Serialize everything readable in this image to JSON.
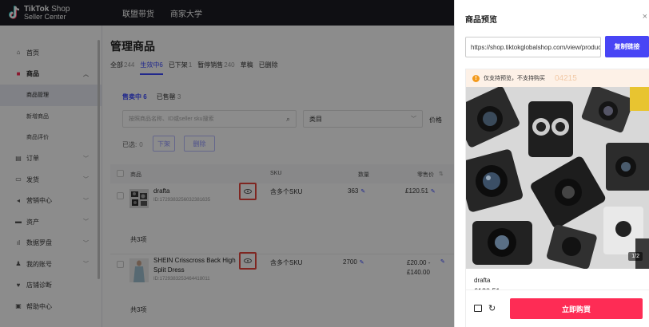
{
  "topbar": {
    "logo_brand": "TikTok",
    "logo_shop": "Shop",
    "logo_sub": "Seller Center",
    "nav": [
      "联盟带货",
      "商家大学"
    ]
  },
  "sidebar": {
    "items": [
      {
        "label": "首页",
        "icon": "home-icon",
        "chevron": ""
      },
      {
        "label": "商品",
        "icon": "product-icon",
        "chevron": "︿"
      },
      {
        "label": "商品管理"
      },
      {
        "label": "新增商品"
      },
      {
        "label": "商品评价"
      },
      {
        "label": "订单",
        "icon": "order-icon",
        "chevron": "﹀"
      },
      {
        "label": "发货",
        "icon": "shipping-icon",
        "chevron": "﹀"
      },
      {
        "label": "营销中心",
        "icon": "marketing-icon",
        "chevron": "﹀"
      },
      {
        "label": "资产",
        "icon": "wallet-icon",
        "chevron": "﹀"
      },
      {
        "label": "数据罗盘",
        "icon": "chart-icon",
        "chevron": "﹀"
      },
      {
        "label": "我的账号",
        "icon": "user-icon",
        "chevron": "﹀"
      },
      {
        "label": "店铺诊断",
        "icon": "heart-icon",
        "chevron": ""
      },
      {
        "label": "帮助中心",
        "icon": "help-icon",
        "chevron": ""
      }
    ]
  },
  "main": {
    "title": "管理商品",
    "tabs": [
      {
        "label": "全部",
        "count": "244"
      },
      {
        "label": "生效中",
        "count": "6"
      },
      {
        "label": "已下架",
        "count": "1"
      },
      {
        "label": "暂停销售",
        "count": "240"
      },
      {
        "label": "草稿",
        "count": ""
      },
      {
        "label": "已删除",
        "count": ""
      }
    ],
    "sub_tabs": [
      {
        "label": "售卖中",
        "count": "6"
      },
      {
        "label": "已售罄",
        "count": "3"
      }
    ],
    "search_placeholder": "按照商品名称、ID或seller sku搜索",
    "category_label": "类目",
    "price_label": "价格",
    "selected_label": "已选:",
    "selected_count": "0",
    "btn_delist": "下架",
    "btn_delete": "删除",
    "columns": {
      "product": "商品",
      "sku": "SKU",
      "qty": "数量",
      "price": "零售价"
    },
    "rows": [
      {
        "name": "drafta",
        "id": "ID:1729383256032381635",
        "sku": "含多个SKU",
        "qty": "363",
        "price": "£120.51",
        "total": "共3项"
      },
      {
        "name": "SHEIN Crisscross Back High Split Dress",
        "id": "ID:1729383253464418011",
        "sku": "含多个SKU",
        "qty": "2700",
        "price": "£20.00 - £140.00",
        "total": "共3项"
      }
    ]
  },
  "drawer": {
    "title": "商品预览",
    "url": "https://shop.tiktokglobalshop.com/view/product",
    "copy_label": "复制链接",
    "notice": "仅支持预览，不支持购买",
    "watermark": "04215",
    "counter": "1/2",
    "product_name": "drafta",
    "price_fragment": "£120.51",
    "buy_label": "立即购買"
  },
  "colors": {
    "accent": "#3c4aff",
    "brand": "#fe2c55",
    "topbar": "#1c1d23",
    "highlight": "#e8453c"
  }
}
